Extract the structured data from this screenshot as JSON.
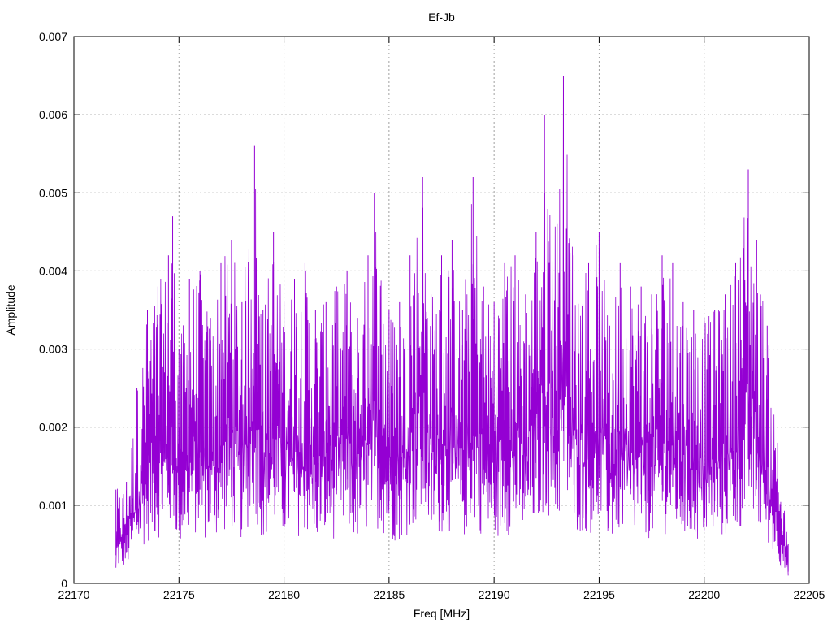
{
  "chart_data": {
    "type": "line",
    "title": "Ef-Jb",
    "xlabel": "Freq [MHz]",
    "ylabel": "Amplitude",
    "xlim": [
      22170,
      22205
    ],
    "ylim": [
      0,
      0.007
    ],
    "x_ticks": [
      "22170",
      "22175",
      "22180",
      "22185",
      "22190",
      "22195",
      "22200",
      "22205"
    ],
    "y_ticks": [
      "0",
      "0.001",
      "0.002",
      "0.003",
      "0.004",
      "0.005",
      "0.006",
      "0.007"
    ],
    "grid": true,
    "series_color": "#9400d3",
    "series": [
      {
        "x": [
          22172.0,
          22172.5,
          22173.0,
          22173.5,
          22174.0,
          22174.5,
          22174.7,
          22175.0,
          22175.5,
          22176.0,
          22176.5,
          22177.0,
          22177.5,
          22178.0,
          22178.6,
          22179.0,
          22179.5,
          22180.0,
          22180.5,
          22181.0,
          22181.5,
          22182.0,
          22182.5,
          22183.0,
          22183.5,
          22184.0,
          22184.3,
          22185.0,
          22185.5,
          22186.0,
          22186.6,
          22187.0,
          22187.5,
          22188.0,
          22188.5,
          22189.0,
          22189.5,
          22190.0,
          22190.5,
          22191.0,
          22191.5,
          22192.0,
          22192.4,
          22193.0,
          22193.3,
          22193.8,
          22194.5,
          22195.0,
          22195.5,
          22196.0,
          22196.5,
          22197.0,
          22197.5,
          22198.0,
          22198.5,
          22199.0,
          22199.5,
          22200.0,
          22200.5,
          22201.0,
          22201.5,
          22202.1,
          22202.5,
          22203.0,
          22203.5,
          22204.0
        ],
        "y": [
          0.0012,
          0.0013,
          0.0025,
          0.0035,
          0.0038,
          0.0042,
          0.0047,
          0.003,
          0.0039,
          0.004,
          0.0034,
          0.0041,
          0.0044,
          0.0036,
          0.0056,
          0.0035,
          0.0045,
          0.0036,
          0.0039,
          0.0041,
          0.0035,
          0.0036,
          0.0038,
          0.004,
          0.0034,
          0.0042,
          0.005,
          0.0035,
          0.0036,
          0.0042,
          0.0052,
          0.0037,
          0.0042,
          0.0044,
          0.0035,
          0.0052,
          0.0038,
          0.0036,
          0.0041,
          0.0042,
          0.0037,
          0.0045,
          0.006,
          0.0046,
          0.0065,
          0.0042,
          0.0041,
          0.0045,
          0.0033,
          0.0041,
          0.0038,
          0.0038,
          0.0037,
          0.0042,
          0.0041,
          0.0036,
          0.0035,
          0.0034,
          0.0035,
          0.0037,
          0.0041,
          0.0053,
          0.0044,
          0.0033,
          0.0018,
          0.0005
        ]
      }
    ]
  }
}
